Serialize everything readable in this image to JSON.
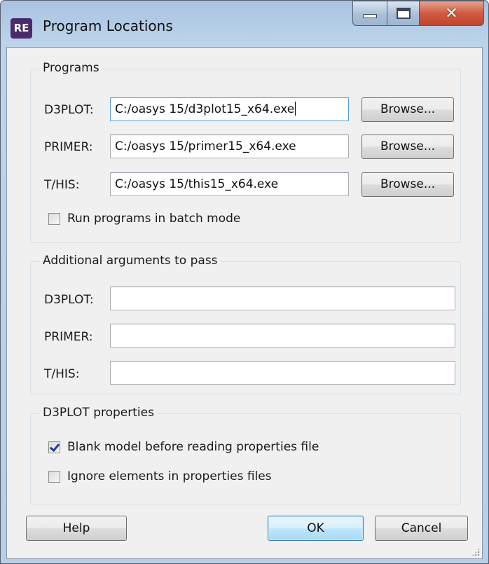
{
  "window": {
    "title": "Program Locations",
    "icon_text": "RE",
    "icon_name": "re-app-icon"
  },
  "programs": {
    "title": "Programs",
    "rows": [
      {
        "label": "D3PLOT:",
        "value": "C:/oasys 15/d3plot15_x64.exe",
        "browse": "Browse..."
      },
      {
        "label": "PRIMER:",
        "value": "C:/oasys 15/primer15_x64.exe",
        "browse": "Browse..."
      },
      {
        "label": "T/HIS:",
        "value": "C:/oasys 15/this15_x64.exe",
        "browse": "Browse..."
      }
    ],
    "batch_label": "Run programs in batch mode",
    "batch_checked": false
  },
  "arguments": {
    "title": "Additional arguments to pass",
    "rows": [
      {
        "label": "D3PLOT:",
        "value": ""
      },
      {
        "label": "PRIMER:",
        "value": ""
      },
      {
        "label": "T/HIS:",
        "value": ""
      }
    ]
  },
  "d3plot_props": {
    "title": "D3PLOT properties",
    "blank_label": "Blank model before reading properties file",
    "blank_checked": true,
    "ignore_label": "Ignore elements in properties files",
    "ignore_checked": false
  },
  "buttons": {
    "help": "Help",
    "ok": "OK",
    "cancel": "Cancel"
  },
  "colors": {
    "accent": "#3c7fb1",
    "titlebar": "#b7cfe7",
    "close": "#c24430"
  }
}
